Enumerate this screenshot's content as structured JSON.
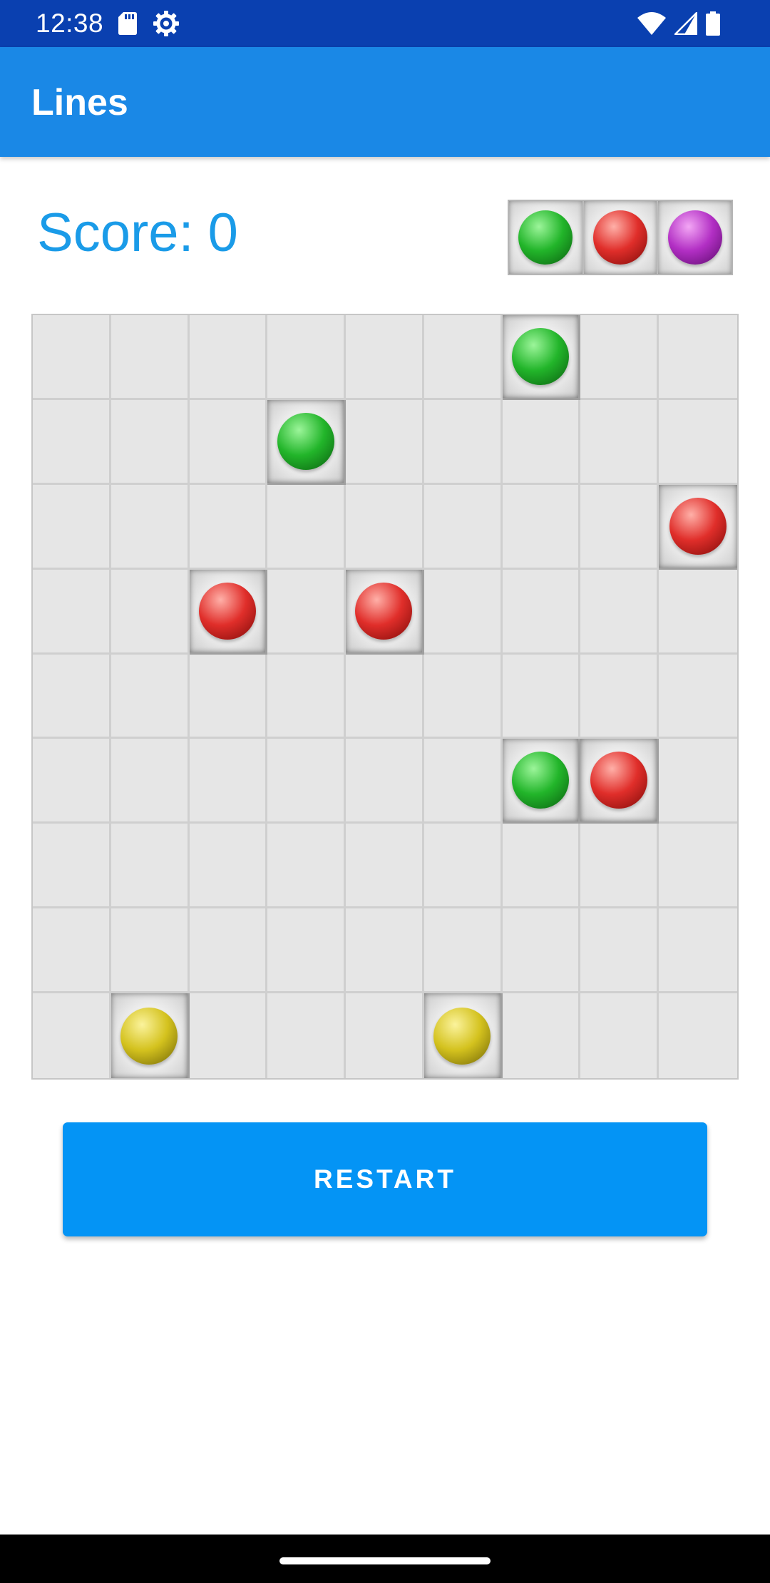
{
  "status_bar": {
    "time": "12:38",
    "left_icons": [
      "sd-card-icon",
      "settings-gear-icon"
    ],
    "right_icons": [
      "wifi-icon",
      "cellular-signal-icon",
      "battery-icon"
    ]
  },
  "app_bar": {
    "title": "Lines"
  },
  "score": {
    "label": "Score:",
    "value": "0"
  },
  "next_balls": [
    "green",
    "red",
    "purple"
  ],
  "board": {
    "rows": 9,
    "cols": 9,
    "balls": [
      {
        "row": 0,
        "col": 6,
        "color": "green"
      },
      {
        "row": 1,
        "col": 3,
        "color": "green"
      },
      {
        "row": 2,
        "col": 8,
        "color": "red"
      },
      {
        "row": 3,
        "col": 2,
        "color": "red"
      },
      {
        "row": 3,
        "col": 4,
        "color": "red"
      },
      {
        "row": 5,
        "col": 6,
        "color": "green"
      },
      {
        "row": 5,
        "col": 7,
        "color": "red"
      },
      {
        "row": 8,
        "col": 1,
        "color": "yellow"
      },
      {
        "row": 8,
        "col": 5,
        "color": "yellow"
      }
    ]
  },
  "ball_colors": {
    "green": {
      "light": "#9cf59a",
      "base": "#22b52a",
      "dark": "#0a5d0f"
    },
    "red": {
      "light": "#ffb0a8",
      "base": "#e02e2a",
      "dark": "#7d0a08"
    },
    "purple": {
      "light": "#f3a6f5",
      "base": "#b22fc4",
      "dark": "#5b0a6b"
    },
    "yellow": {
      "light": "#fbf39c",
      "base": "#d4c21e",
      "dark": "#6f6406"
    }
  },
  "restart_button": {
    "label": "RESTART"
  },
  "theme": {
    "status_bar": "#0a40b0",
    "app_bar": "#1a88e6",
    "score_text": "#1a9be8",
    "button": "#0494f5"
  }
}
